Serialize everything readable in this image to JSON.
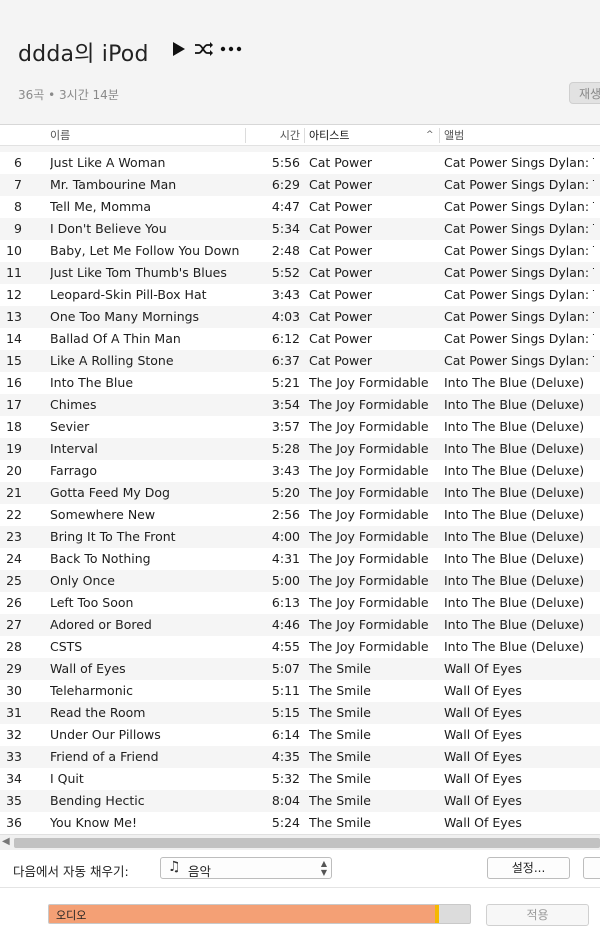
{
  "header": {
    "title": "ddda의 iPod",
    "summary": "36곡 • 3시간 14분",
    "sync_label": "재생",
    "play_icon": "play-icon",
    "shuffle_icon": "shuffle-icon",
    "more_icon": "more-icon"
  },
  "columns": {
    "name": "이름",
    "time": "시간",
    "artist": "아티스트",
    "album": "앨범",
    "sort_indicator": "^"
  },
  "tracks": [
    {
      "num": "6",
      "name": "Just Like A Woman",
      "time": "5:56",
      "artist": "Cat Power",
      "album": "Cat Power Sings Dylan: T..."
    },
    {
      "num": "7",
      "name": "Mr. Tambourine Man",
      "time": "6:29",
      "artist": "Cat Power",
      "album": "Cat Power Sings Dylan: T..."
    },
    {
      "num": "8",
      "name": "Tell Me, Momma",
      "time": "4:47",
      "artist": "Cat Power",
      "album": "Cat Power Sings Dylan: T..."
    },
    {
      "num": "9",
      "name": "I Don't Believe You",
      "time": "5:34",
      "artist": "Cat Power",
      "album": "Cat Power Sings Dylan: T..."
    },
    {
      "num": "10",
      "name": "Baby, Let Me Follow You Down",
      "time": "2:48",
      "artist": "Cat Power",
      "album": "Cat Power Sings Dylan: T..."
    },
    {
      "num": "11",
      "name": "Just Like Tom Thumb's Blues",
      "time": "5:52",
      "artist": "Cat Power",
      "album": "Cat Power Sings Dylan: T..."
    },
    {
      "num": "12",
      "name": "Leopard-Skin Pill-Box Hat",
      "time": "3:43",
      "artist": "Cat Power",
      "album": "Cat Power Sings Dylan: T..."
    },
    {
      "num": "13",
      "name": "One Too Many Mornings",
      "time": "4:03",
      "artist": "Cat Power",
      "album": "Cat Power Sings Dylan: T..."
    },
    {
      "num": "14",
      "name": "Ballad Of A Thin Man",
      "time": "6:12",
      "artist": "Cat Power",
      "album": "Cat Power Sings Dylan: T..."
    },
    {
      "num": "15",
      "name": "Like A Rolling Stone",
      "time": "6:37",
      "artist": "Cat Power",
      "album": "Cat Power Sings Dylan: T..."
    },
    {
      "num": "16",
      "name": "Into The Blue",
      "time": "5:21",
      "artist": "The Joy Formidable",
      "album": "Into The Blue (Deluxe)"
    },
    {
      "num": "17",
      "name": "Chimes",
      "time": "3:54",
      "artist": "The Joy Formidable",
      "album": "Into The Blue (Deluxe)"
    },
    {
      "num": "18",
      "name": "Sevier",
      "time": "3:57",
      "artist": "The Joy Formidable",
      "album": "Into The Blue (Deluxe)"
    },
    {
      "num": "19",
      "name": "Interval",
      "time": "5:28",
      "artist": "The Joy Formidable",
      "album": "Into The Blue (Deluxe)"
    },
    {
      "num": "20",
      "name": "Farrago",
      "time": "3:43",
      "artist": "The Joy Formidable",
      "album": "Into The Blue (Deluxe)"
    },
    {
      "num": "21",
      "name": "Gotta Feed My Dog",
      "time": "5:20",
      "artist": "The Joy Formidable",
      "album": "Into The Blue (Deluxe)"
    },
    {
      "num": "22",
      "name": "Somewhere New",
      "time": "2:56",
      "artist": "The Joy Formidable",
      "album": "Into The Blue (Deluxe)"
    },
    {
      "num": "23",
      "name": "Bring It To The Front",
      "time": "4:00",
      "artist": "The Joy Formidable",
      "album": "Into The Blue (Deluxe)"
    },
    {
      "num": "24",
      "name": "Back To Nothing",
      "time": "4:31",
      "artist": "The Joy Formidable",
      "album": "Into The Blue (Deluxe)"
    },
    {
      "num": "25",
      "name": "Only Once",
      "time": "5:00",
      "artist": "The Joy Formidable",
      "album": "Into The Blue (Deluxe)"
    },
    {
      "num": "26",
      "name": "Left Too Soon",
      "time": "6:13",
      "artist": "The Joy Formidable",
      "album": "Into The Blue (Deluxe)"
    },
    {
      "num": "27",
      "name": "Adored or Bored",
      "time": "4:46",
      "artist": "The Joy Formidable",
      "album": "Into The Blue (Deluxe)"
    },
    {
      "num": "28",
      "name": "CSTS",
      "time": "4:55",
      "artist": "The Joy Formidable",
      "album": "Into The Blue (Deluxe)"
    },
    {
      "num": "29",
      "name": "Wall of Eyes",
      "time": "5:07",
      "artist": "The Smile",
      "album": "Wall Of Eyes"
    },
    {
      "num": "30",
      "name": "Teleharmonic",
      "time": "5:11",
      "artist": "The Smile",
      "album": "Wall Of Eyes"
    },
    {
      "num": "31",
      "name": "Read the Room",
      "time": "5:15",
      "artist": "The Smile",
      "album": "Wall Of Eyes"
    },
    {
      "num": "32",
      "name": "Under Our Pillows",
      "time": "6:14",
      "artist": "The Smile",
      "album": "Wall Of Eyes"
    },
    {
      "num": "33",
      "name": "Friend of a Friend",
      "time": "4:35",
      "artist": "The Smile",
      "album": "Wall Of Eyes"
    },
    {
      "num": "34",
      "name": "I Quit",
      "time": "5:32",
      "artist": "The Smile",
      "album": "Wall Of Eyes"
    },
    {
      "num": "35",
      "name": "Bending Hectic",
      "time": "8:04",
      "artist": "The Smile",
      "album": "Wall Of Eyes"
    },
    {
      "num": "36",
      "name": "You Know Me!",
      "time": "5:24",
      "artist": "The Smile",
      "album": "Wall Of Eyes"
    }
  ],
  "autofill": {
    "label": "다음에서 자동 채우기:",
    "value": "음악",
    "icon": "music-note-icon",
    "settings_label": "설정..."
  },
  "footer": {
    "audio_label": "오디오",
    "audio_fraction": 0.917,
    "other_fraction": 0.01,
    "apply_label": "적용"
  },
  "colors": {
    "audio": "#f4a075",
    "other": "#f5b800",
    "free": "#dcdcdc",
    "row_alt": "#f5f5f5"
  }
}
